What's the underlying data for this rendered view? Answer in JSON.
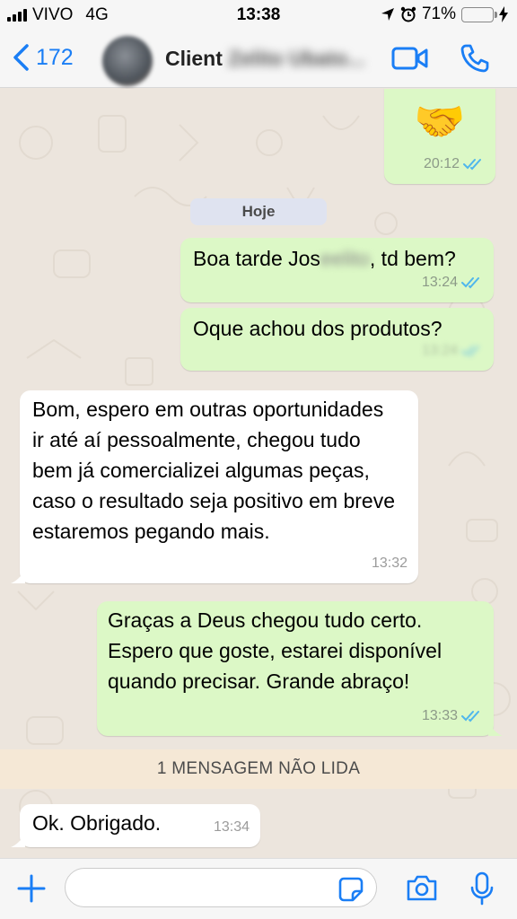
{
  "status_bar": {
    "carrier": "VIVO",
    "network": "4G",
    "time": "13:38",
    "battery": "71%",
    "battery_level": 0.71
  },
  "header": {
    "back_count": "172",
    "contact_name": "Client ",
    "contact_name_blurred": "Zelito Ubato...",
    "accent_color": "#1a7ef5"
  },
  "chat": {
    "prev_message": {
      "emoji": "🤝",
      "time": "20:12"
    },
    "day_label": "Hoje",
    "messages": [
      {
        "dir": "out",
        "text_before": "Boa tarde Jos",
        "text_blur": "eelito",
        "text_after": ", td bem?",
        "time": "13:24"
      },
      {
        "dir": "out",
        "text": "Oque achou dos produtos?",
        "time": "13:24"
      },
      {
        "dir": "in",
        "text": "Bom, espero em outras oportunidades ir até aí pessoalmente, chegou tudo bem já comercializei algumas peças, caso o resultado seja positivo em breve estaremos pegando mais.",
        "time": "13:32"
      },
      {
        "dir": "out",
        "text": "Graças a Deus chegou tudo certo. Espero que goste, estarei disponível quando precisar. Grande abraço!",
        "time": "13:33"
      },
      {
        "dir": "in",
        "text": "Ok. Obrigado.",
        "time": "13:34"
      }
    ],
    "unread_banner": "1 MENSAGEM NÃO LIDA"
  },
  "input_bar": {
    "message_value": ""
  },
  "colors": {
    "outgoing_bubble": "#dcf8c6",
    "incoming_bubble": "#ffffff",
    "chat_background": "#ece5dd",
    "read_ticks": "#4fb6ec"
  }
}
